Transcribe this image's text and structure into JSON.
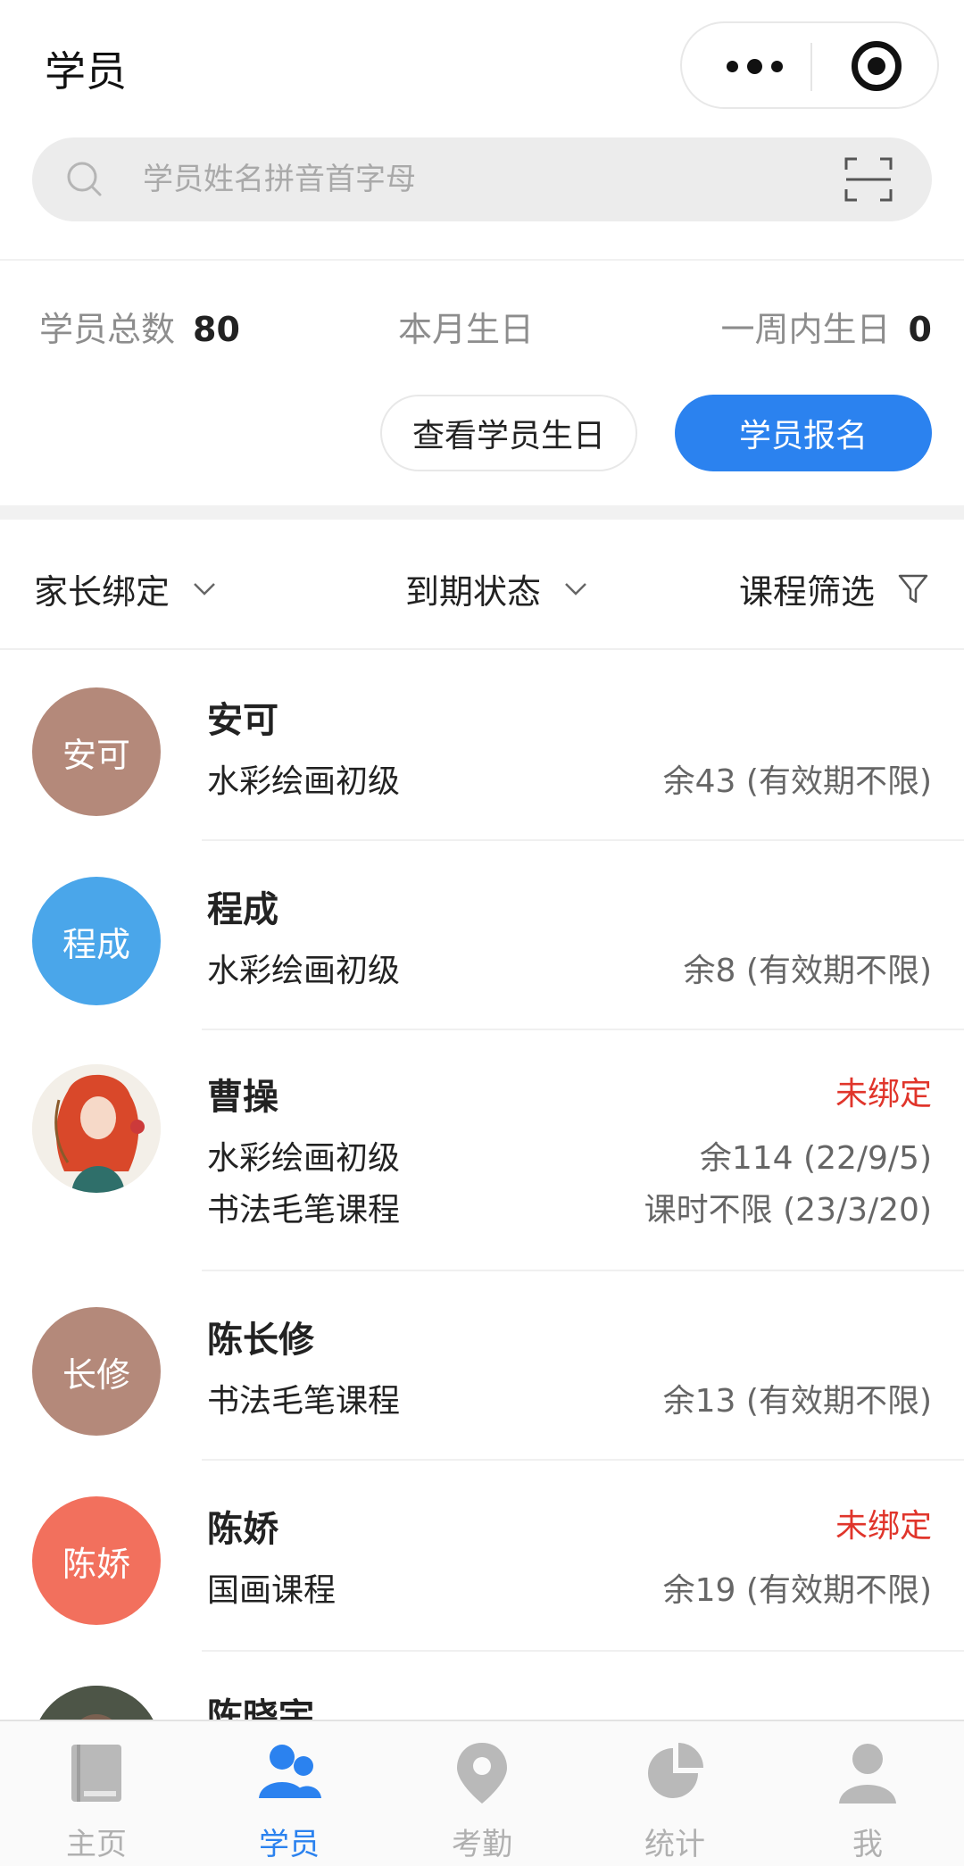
{
  "header": {
    "title": "学员"
  },
  "search": {
    "placeholder": "学员姓名拼音首字母"
  },
  "stats": {
    "total_label": "学员总数",
    "total_value": "80",
    "month_label": "本月生日",
    "week_label": "一周内生日",
    "week_value": "0"
  },
  "actions": {
    "view_birthday": "查看学员生日",
    "enroll": "学员报名"
  },
  "filters": {
    "parent_binding": "家长绑定",
    "expiry_status": "到期状态",
    "course_filter": "课程筛选"
  },
  "students": [
    {
      "avatar_text": "安可",
      "avatar_color": "#b4897a",
      "name": "安可",
      "status": "",
      "courses": [
        {
          "name": "水彩绘画初级",
          "remain": "余43 (有效期不限)"
        }
      ]
    },
    {
      "avatar_text": "程成",
      "avatar_color": "#4aa6ea",
      "name": "程成",
      "status": "",
      "courses": [
        {
          "name": "水彩绘画初级",
          "remain": "余8 (有效期不限)"
        }
      ]
    },
    {
      "avatar_text": "",
      "avatar_color": "#f3efe8",
      "avatar_image": "illustrated-girl-portrait",
      "name": "曹操",
      "status": "未绑定",
      "courses": [
        {
          "name": "水彩绘画初级",
          "remain": "余114 (22/9/5)"
        },
        {
          "name": "书法毛笔课程",
          "remain": "课时不限 (23/3/20)"
        }
      ]
    },
    {
      "avatar_text": "长修",
      "avatar_color": "#b4897a",
      "name": "陈长修",
      "status": "",
      "courses": [
        {
          "name": "书法毛笔课程",
          "remain": "余13 (有效期不限)"
        }
      ]
    },
    {
      "avatar_text": "陈娇",
      "avatar_color": "#f2705d",
      "name": "陈娇",
      "status": "未绑定",
      "courses": [
        {
          "name": "国画课程",
          "remain": "余19 (有效期不限)"
        }
      ]
    },
    {
      "avatar_text": "",
      "avatar_color": "#3a3f36",
      "avatar_image": "photo-portrait",
      "name": "陈晓宇",
      "status": "",
      "courses": []
    }
  ],
  "tabbar": [
    {
      "label": "主页",
      "icon": "book-icon",
      "active": false
    },
    {
      "label": "学员",
      "icon": "users-icon",
      "active": true
    },
    {
      "label": "考勤",
      "icon": "location-pin-icon",
      "active": false
    },
    {
      "label": "统计",
      "icon": "pie-chart-icon",
      "active": false
    },
    {
      "label": "我",
      "icon": "user-icon",
      "active": false
    }
  ],
  "colors": {
    "accent": "#2b82ef",
    "warning": "#e0352b",
    "inactive": "#b0b0b0"
  }
}
